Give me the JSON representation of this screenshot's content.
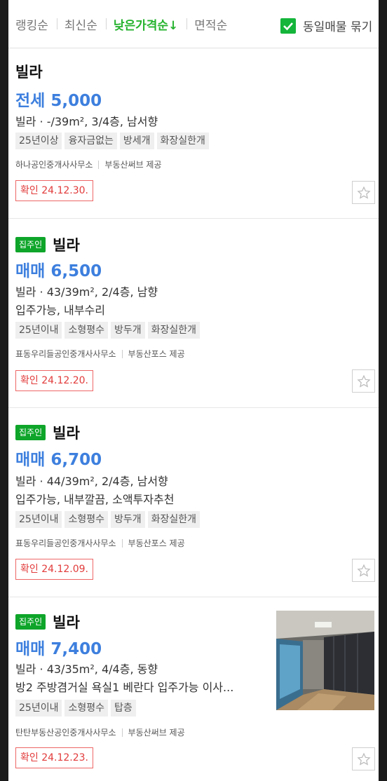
{
  "sort": {
    "items": [
      "랭킹순",
      "최신순",
      "낮은가격순↓",
      "면적순"
    ],
    "duplicate_label": "동일매물 묶기",
    "active_color": "#26b32f"
  },
  "listings": [
    {
      "owner_badge": "",
      "type": "빌라",
      "price": "전세 5,000",
      "spec": "빌라 · -/39m², 3/4층, 남서향",
      "desc": "",
      "tags": [
        "25년이상",
        "융자금없는",
        "방세개",
        "화장실한개"
      ],
      "agent": "하나공인중개사사무소",
      "provider": "부동산써브 제공",
      "confirm": "확인 24.12.30."
    },
    {
      "owner_badge": "집주인",
      "type": "빌라",
      "price": "매매 6,500",
      "spec": "빌라 · 43/39m², 2/4층, 남향",
      "desc": "입주가능, 내부수리",
      "tags": [
        "25년이내",
        "소형평수",
        "방두개",
        "화장실한개"
      ],
      "agent": "표동우리들공인중개사사무소",
      "provider": "부동산포스 제공",
      "confirm": "확인 24.12.20."
    },
    {
      "owner_badge": "집주인",
      "type": "빌라",
      "price": "매매 6,700",
      "spec": "빌라 · 44/39m², 2/4층, 남서향",
      "desc": "입주가능, 내부깔끔, 소액투자추천",
      "tags": [
        "25년이내",
        "소형평수",
        "방두개",
        "화장실한개"
      ],
      "agent": "표동우리들공인중개사사무소",
      "provider": "부동산포스 제공",
      "confirm": "확인 24.12.09."
    },
    {
      "owner_badge": "집주인",
      "type": "빌라",
      "price": "매매 7,400",
      "spec": "빌라 · 43/35m², 4/4층, 동향",
      "desc": "방2 주방겸거실 욕실1 베란다 입주가능 이사...",
      "tags": [
        "25년이내",
        "소형평수",
        "탑층"
      ],
      "agent": "탄탄부동산공인중개사사무소",
      "provider": "부동산써브 제공",
      "confirm": "확인 24.12.23."
    }
  ]
}
